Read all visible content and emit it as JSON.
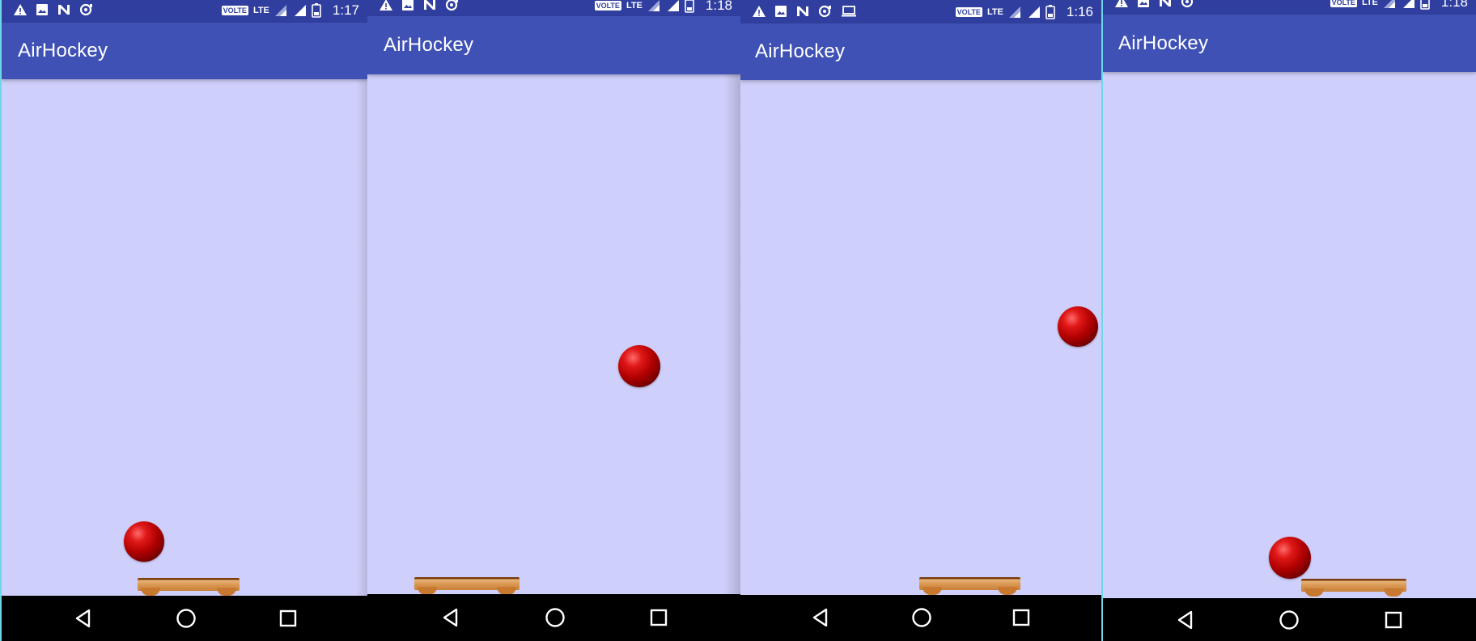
{
  "app_title": "AirHockey",
  "colors": {
    "status_bar": "#303f9f",
    "app_bar": "#3f51b5",
    "game_background": "#cfcffb",
    "nav_bar": "#000000",
    "ball": "#b00000",
    "paddle": "#d9964f"
  },
  "screens": [
    {
      "clock": "1:17",
      "status_icons_left": [
        "warning-icon",
        "image-icon",
        "n-icon",
        "sync-icon"
      ],
      "volte": "VOLTE",
      "network": "LTE"
    },
    {
      "clock": "1:18",
      "status_icons_left": [
        "warning-icon",
        "image-icon",
        "n-icon",
        "sync-icon"
      ],
      "volte": "VOLTE",
      "network": "LTE"
    },
    {
      "clock": "1:16",
      "status_icons_left": [
        "warning-icon",
        "image-icon",
        "n-icon",
        "sync-icon",
        "laptop-icon"
      ],
      "volte": "VOLTE",
      "network": "LTE"
    },
    {
      "clock": "1:18",
      "status_icons_left": [
        "warning-icon",
        "image-icon",
        "n-icon",
        "sync-icon"
      ],
      "volte": "VOLTE",
      "network": "LTE"
    }
  ],
  "nav": {
    "back": "back-icon",
    "home": "home-icon",
    "recents": "recents-icon"
  }
}
